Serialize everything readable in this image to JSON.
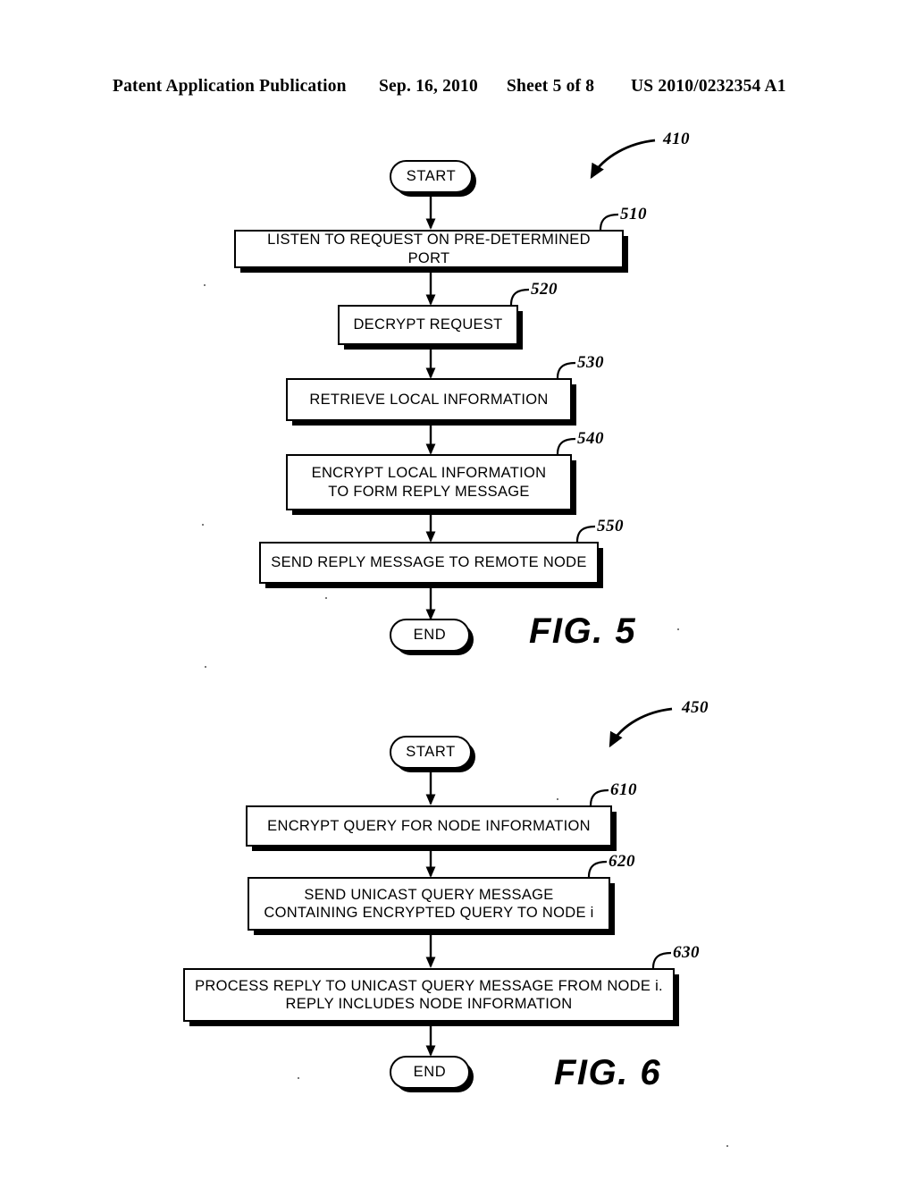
{
  "header": {
    "publication": "Patent Application Publication",
    "date": "Sep. 16, 2010",
    "sheet": "Sheet 5 of 8",
    "patent_number": "US 2010/0232354 A1"
  },
  "figures": [
    {
      "caption": "FIG. 5",
      "flow_ref": "410",
      "start_label": "START",
      "end_label": "END",
      "steps": [
        {
          "ref": "510",
          "text": "LISTEN TO REQUEST ON PRE-DETERMINED PORT"
        },
        {
          "ref": "520",
          "text": "DECRYPT REQUEST"
        },
        {
          "ref": "530",
          "text": "RETRIEVE LOCAL INFORMATION"
        },
        {
          "ref": "540",
          "text": "ENCRYPT LOCAL INFORMATION\nTO FORM REPLY MESSAGE"
        },
        {
          "ref": "550",
          "text": "SEND REPLY MESSAGE TO REMOTE NODE"
        }
      ]
    },
    {
      "caption": "FIG. 6",
      "flow_ref": "450",
      "start_label": "START",
      "end_label": "END",
      "steps": [
        {
          "ref": "610",
          "text": "ENCRYPT QUERY FOR NODE INFORMATION"
        },
        {
          "ref": "620",
          "text": "SEND UNICAST QUERY MESSAGE\nCONTAINING ENCRYPTED QUERY TO NODE i"
        },
        {
          "ref": "630",
          "text": "PROCESS REPLY TO UNICAST QUERY MESSAGE FROM NODE i.\nREPLY INCLUDES NODE INFORMATION"
        }
      ]
    }
  ],
  "colors": {
    "ink": "#000000",
    "paper": "#ffffff"
  }
}
